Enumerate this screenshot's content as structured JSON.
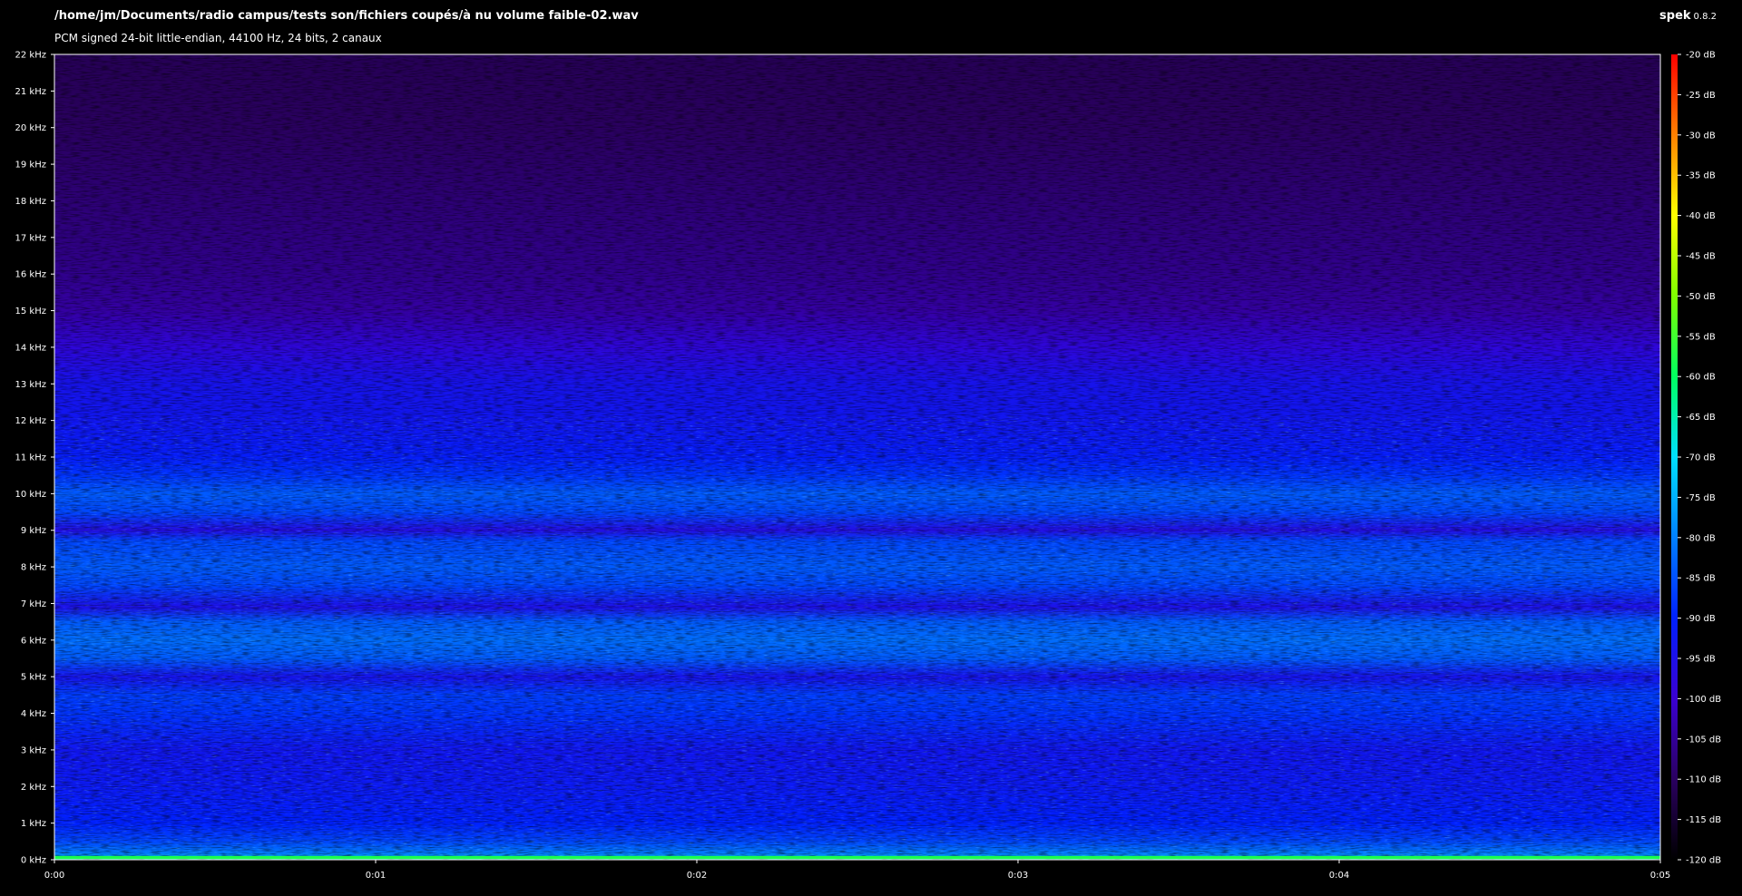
{
  "header": {
    "file_path": "/home/jm/Documents/radio campus/tests son/fichiers coupés/à nu volume faible-02.wav",
    "file_info": "PCM signed 24-bit little-endian, 44100 Hz, 24 bits, 2 canaux",
    "app_name": "spek",
    "app_version": "0.8.2"
  },
  "chart_data": {
    "type": "heatmap",
    "title": "",
    "xlabel": "",
    "ylabel": "",
    "x_ticks": [
      "0:00",
      "0:01",
      "0:02",
      "0:03",
      "0:04",
      "0:05"
    ],
    "x_range_seconds": [
      0,
      5
    ],
    "y_ticks": [
      "0 kHz",
      "1 kHz",
      "2 kHz",
      "3 kHz",
      "4 kHz",
      "5 kHz",
      "6 kHz",
      "7 kHz",
      "8 kHz",
      "9 kHz",
      "10 kHz",
      "11 kHz",
      "12 kHz",
      "13 kHz",
      "14 kHz",
      "15 kHz",
      "16 kHz",
      "17 kHz",
      "18 kHz",
      "19 kHz",
      "20 kHz",
      "21 kHz",
      "22 kHz"
    ],
    "y_range_khz": [
      0,
      22
    ],
    "scale_ticks": [
      "-20 dB",
      "-25 dB",
      "-30 dB",
      "-35 dB",
      "-40 dB",
      "-45 dB",
      "-50 dB",
      "-55 dB",
      "-60 dB",
      "-65 dB",
      "-70 dB",
      "-75 dB",
      "-80 dB",
      "-85 dB",
      "-90 dB",
      "-95 dB",
      "-100 dB",
      "-105 dB",
      "-110 dB",
      "-115 dB",
      "-120 dB"
    ],
    "scale_range_db": [
      -120,
      -20
    ],
    "colormap": [
      "#000000",
      "#2a0060",
      "#3a00d0",
      "#0020ff",
      "#0080ff",
      "#00e0ff",
      "#00ff60",
      "#80ff00",
      "#ffff00",
      "#ff8000",
      "#ff0000"
    ],
    "level_profile_db": [
      {
        "khz": 0.0,
        "db": -62
      },
      {
        "khz": 0.15,
        "db": -80
      },
      {
        "khz": 0.5,
        "db": -86
      },
      {
        "khz": 1.0,
        "db": -90
      },
      {
        "khz": 2.0,
        "db": -92
      },
      {
        "khz": 3.0,
        "db": -93
      },
      {
        "khz": 4.0,
        "db": -88
      },
      {
        "khz": 4.5,
        "db": -87
      },
      {
        "khz": 5.0,
        "db": -94
      },
      {
        "khz": 5.5,
        "db": -84
      },
      {
        "khz": 6.0,
        "db": -82
      },
      {
        "khz": 6.5,
        "db": -84
      },
      {
        "khz": 6.9,
        "db": -95
      },
      {
        "khz": 7.5,
        "db": -86
      },
      {
        "khz": 8.0,
        "db": -84
      },
      {
        "khz": 8.7,
        "db": -86
      },
      {
        "khz": 9.0,
        "db": -96
      },
      {
        "khz": 9.5,
        "db": -86
      },
      {
        "khz": 10.0,
        "db": -84
      },
      {
        "khz": 10.5,
        "db": -88
      },
      {
        "khz": 11.0,
        "db": -91
      },
      {
        "khz": 12.0,
        "db": -93
      },
      {
        "khz": 13.0,
        "db": -94
      },
      {
        "khz": 14.0,
        "db": -98
      },
      {
        "khz": 15.0,
        "db": -104
      },
      {
        "khz": 16.0,
        "db": -106
      },
      {
        "khz": 18.0,
        "db": -108
      },
      {
        "khz": 20.0,
        "db": -110
      },
      {
        "khz": 22.0,
        "db": -111
      }
    ]
  }
}
